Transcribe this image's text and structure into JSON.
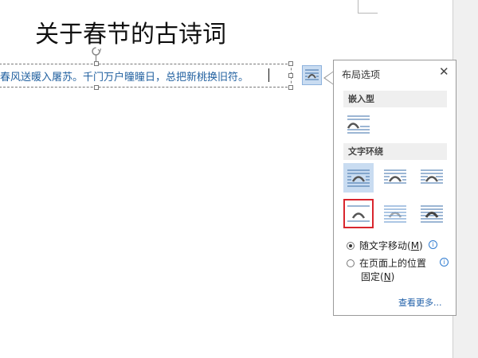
{
  "document": {
    "title": "关于春节的古诗词",
    "textbox_text": "春风送暖入屠苏。千门万户曈曈日，总把新桃换旧符。"
  },
  "layout_options": {
    "pane_title": "布局选项",
    "close_glyph": "✕",
    "inline_section": "嵌入型",
    "wrap_section": "文字环绕",
    "move_with_text": {
      "label": "随文字移动(",
      "key": "M",
      "suffix": ")",
      "checked": true
    },
    "fix_position": {
      "line1": "在页面上的位置",
      "line2_prefix": "固定(",
      "key": "N",
      "suffix": ")",
      "checked": false
    },
    "see_more": "查看更多..."
  },
  "colors": {
    "accent": "#c9dcf1",
    "highlight": "#d9262e",
    "text_blue": "#1f5f9f"
  }
}
